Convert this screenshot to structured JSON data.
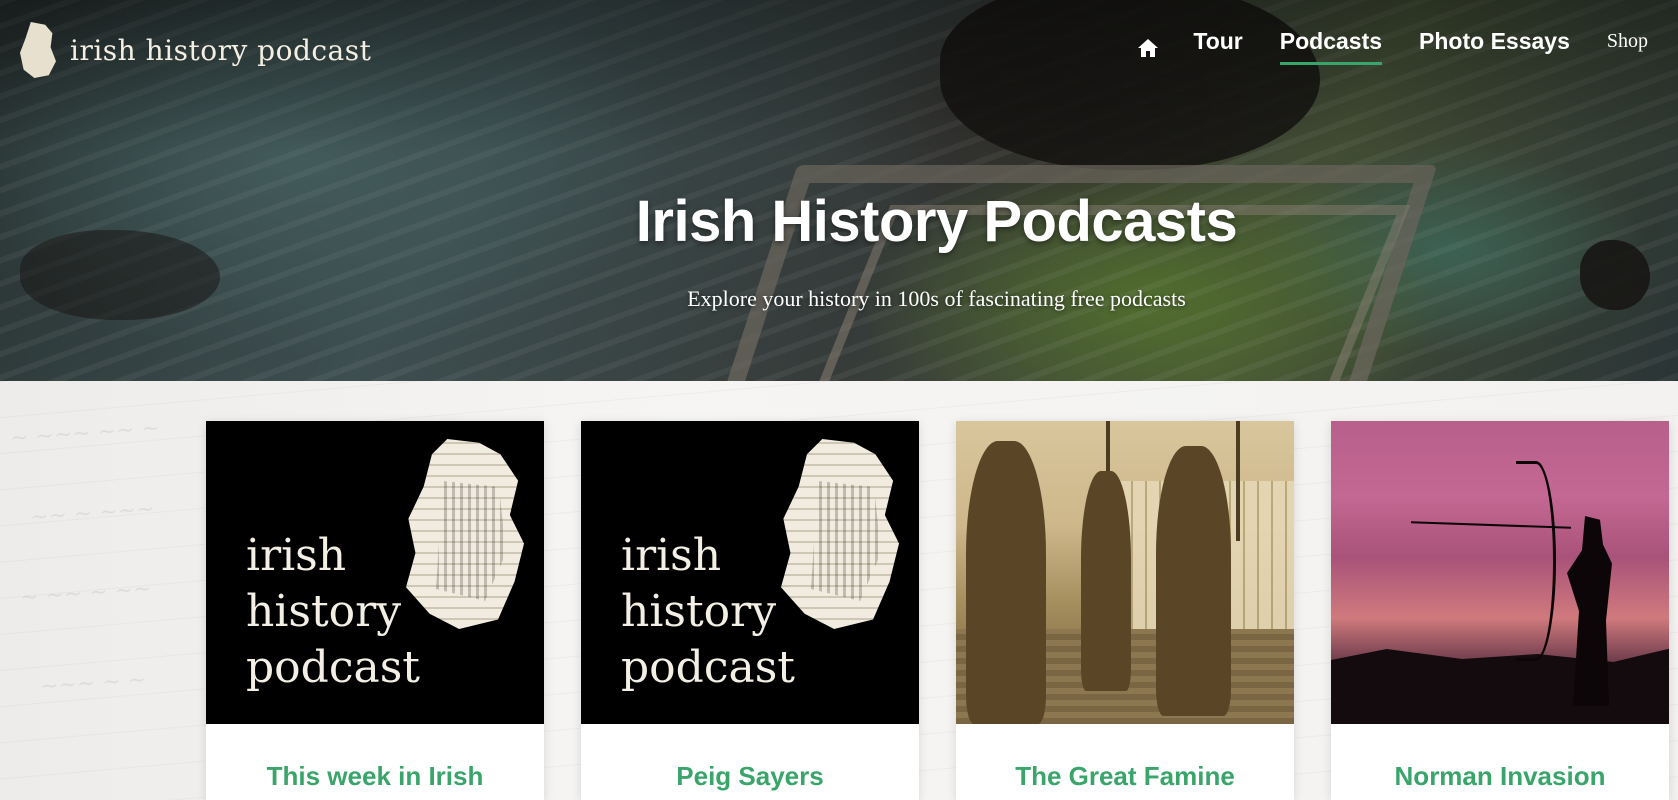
{
  "site": {
    "logo_text": "irish history podcast"
  },
  "nav": {
    "items": [
      {
        "label": "Tour"
      },
      {
        "label": "Podcasts",
        "active": true
      },
      {
        "label": "Photo Essays"
      },
      {
        "label": "Shop"
      }
    ],
    "home_icon": "home-icon"
  },
  "hero": {
    "title": "Irish History Podcasts",
    "subtitle": "Explore your history in 100s of fascinating free podcasts"
  },
  "cards": [
    {
      "title": "This week in Irish",
      "image_wordmark": [
        "irish",
        "history",
        "podcast"
      ]
    },
    {
      "title": "Peig Sayers",
      "image_wordmark": [
        "irish",
        "history",
        "podcast"
      ]
    },
    {
      "title": "The Great Famine"
    },
    {
      "title": "Norman Invasion"
    }
  ],
  "colors": {
    "accent": "#3aa56b",
    "card_title": "#3aa56b"
  }
}
